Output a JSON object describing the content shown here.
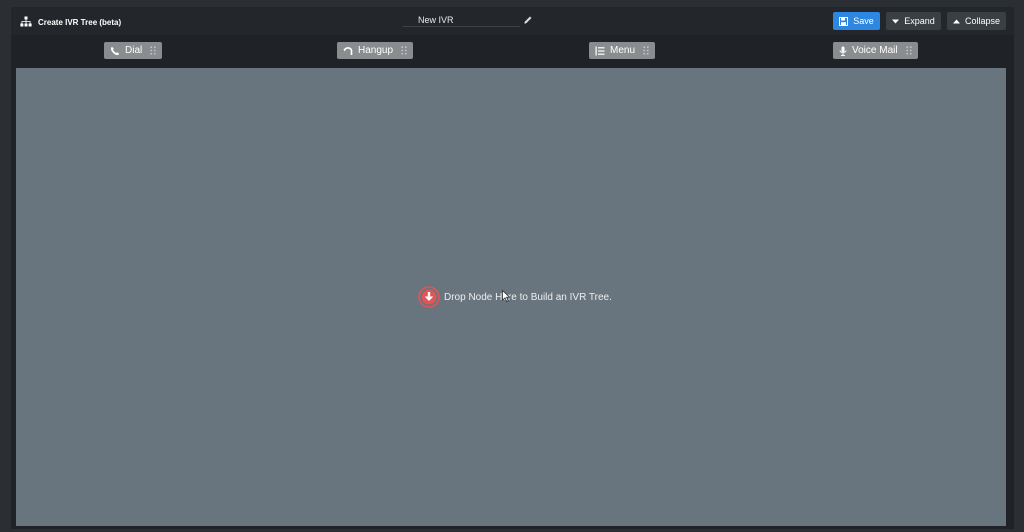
{
  "header": {
    "title": "Create IVR Tree (beta)",
    "ivr_name": "New IVR",
    "buttons": {
      "save": "Save",
      "expand": "Expand",
      "collapse": "Collapse"
    }
  },
  "toolbar": {
    "nodes": [
      {
        "label": "Dial",
        "icon": "phone-icon"
      },
      {
        "label": "Hangup",
        "icon": "hangup-icon"
      },
      {
        "label": "Menu",
        "icon": "menu-list-icon"
      },
      {
        "label": "Voice Mail",
        "icon": "microphone-icon"
      }
    ]
  },
  "canvas": {
    "drop_hint": "Drop Node Here to Build an IVR Tree."
  },
  "colors": {
    "save_button": "#2d86df",
    "canvas_bg": "#68757e",
    "drop_icon": "#e05555"
  }
}
